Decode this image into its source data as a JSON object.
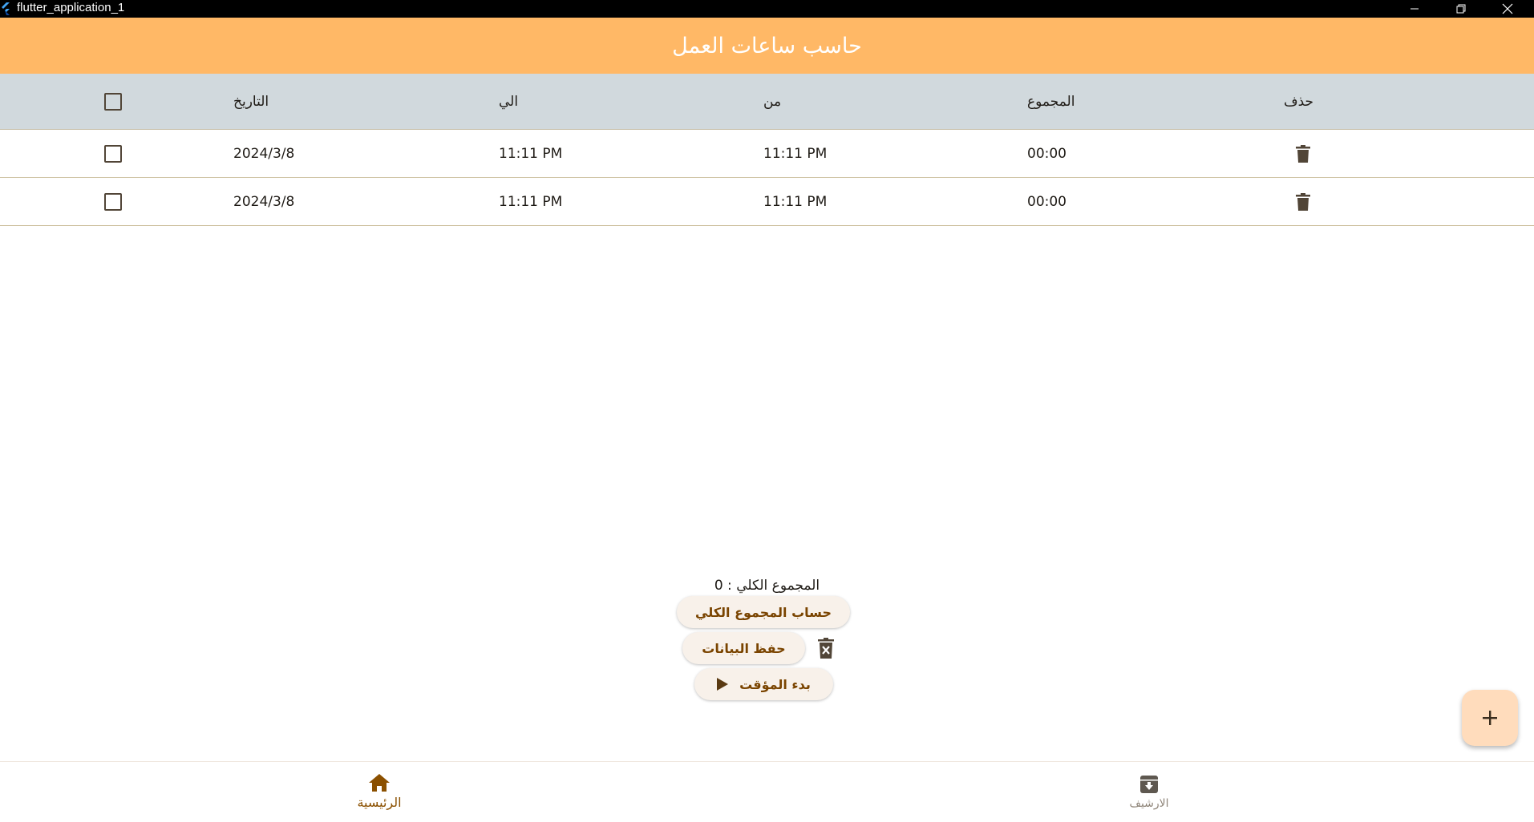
{
  "window": {
    "title": "flutter_application_1"
  },
  "appbar": {
    "title": "حاسب ساعات العمل"
  },
  "table": {
    "headers": {
      "delete": "حذف",
      "total": "المجموع",
      "from": "من",
      "to": "الي",
      "date": "التاريخ"
    },
    "rows": [
      {
        "total": "00:00",
        "from": "11:11 PM",
        "to": "11:11 PM",
        "date": "2024/3/8",
        "checked": false
      },
      {
        "total": "00:00",
        "from": "11:11 PM",
        "to": "11:11 PM",
        "date": "2024/3/8",
        "checked": false
      }
    ]
  },
  "summary": {
    "total_text": "المجموع الكلي : 0",
    "calculate_label": "حساب المجموع الكلي",
    "save_label": "حفظ البيانات",
    "start_timer_label": "بدء المؤقت"
  },
  "bottom_nav": {
    "items": [
      {
        "label": "الرئيسية",
        "icon": "home-icon",
        "active": true
      },
      {
        "label": "الارشيف",
        "icon": "archive-icon",
        "active": false
      }
    ]
  },
  "colors": {
    "appbar": "#ffb866",
    "header_row": "#d1d9dd",
    "accent_text": "#7a4400",
    "fab": "#ffdcbc",
    "nav_active": "#8b5000"
  }
}
